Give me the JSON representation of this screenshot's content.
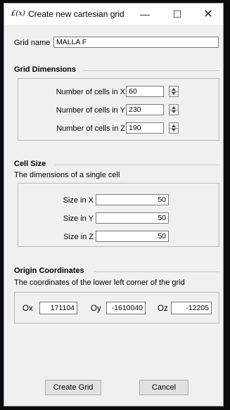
{
  "window": {
    "icon_text": "£(x)",
    "title": "Create new cartesian grid",
    "controls": {
      "minimize": "—",
      "maximize": "☐",
      "close": "✕"
    }
  },
  "grid_name": {
    "label": "Grid name",
    "value": "MALLA F"
  },
  "grid_dimensions": {
    "heading": "Grid Dimensions",
    "rows": [
      {
        "label": "Number of cells in X",
        "value": "60"
      },
      {
        "label": "Number of cells in Y",
        "value": "230"
      },
      {
        "label": "Number of cells in Z",
        "value": "190"
      }
    ]
  },
  "cell_size": {
    "heading": "Cell Size",
    "description": "The dimensions of a single cell",
    "rows": [
      {
        "label": "Size in X",
        "value": "50"
      },
      {
        "label": "Size in Y",
        "value": "50"
      },
      {
        "label": "Size in Z",
        "value": "50"
      }
    ]
  },
  "origin": {
    "heading": "Origin Coordinates",
    "description": "The coordinates of the lower left corner of the grid",
    "fields": [
      {
        "label": "Ox",
        "value": "171104"
      },
      {
        "label": "Oy",
        "value": "-1610040"
      },
      {
        "label": "Oz",
        "value": "-12205"
      }
    ]
  },
  "buttons": {
    "create": "Create Grid",
    "cancel": "Cancel"
  }
}
